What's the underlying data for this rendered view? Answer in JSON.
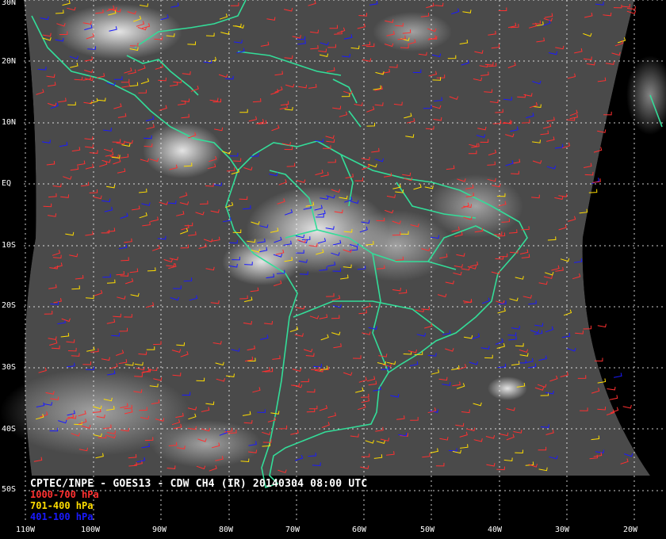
{
  "map": {
    "caption": "CPTEC/INPE - GOES13 - CDW CH4 (IR) 20140304 08:00 UTC",
    "lat_labels": [
      "30N",
      "20N",
      "10N",
      "EQ",
      "10S",
      "20S",
      "30S",
      "40S",
      "50S"
    ],
    "lon_labels": [
      "110W",
      "100W",
      "90W",
      "80W",
      "70W",
      "60W",
      "50W",
      "40W",
      "30W",
      "20W"
    ],
    "legend": [
      {
        "label": "1000-700 hPa",
        "color": "#ff3030"
      },
      {
        "label": "701-400 hPa",
        "color": "#ffdd00"
      },
      {
        "label": "401-100 hPa",
        "color": "#1a1aff"
      }
    ],
    "coastline_color": "#33dd99",
    "grid_color": "#ffffff"
  }
}
